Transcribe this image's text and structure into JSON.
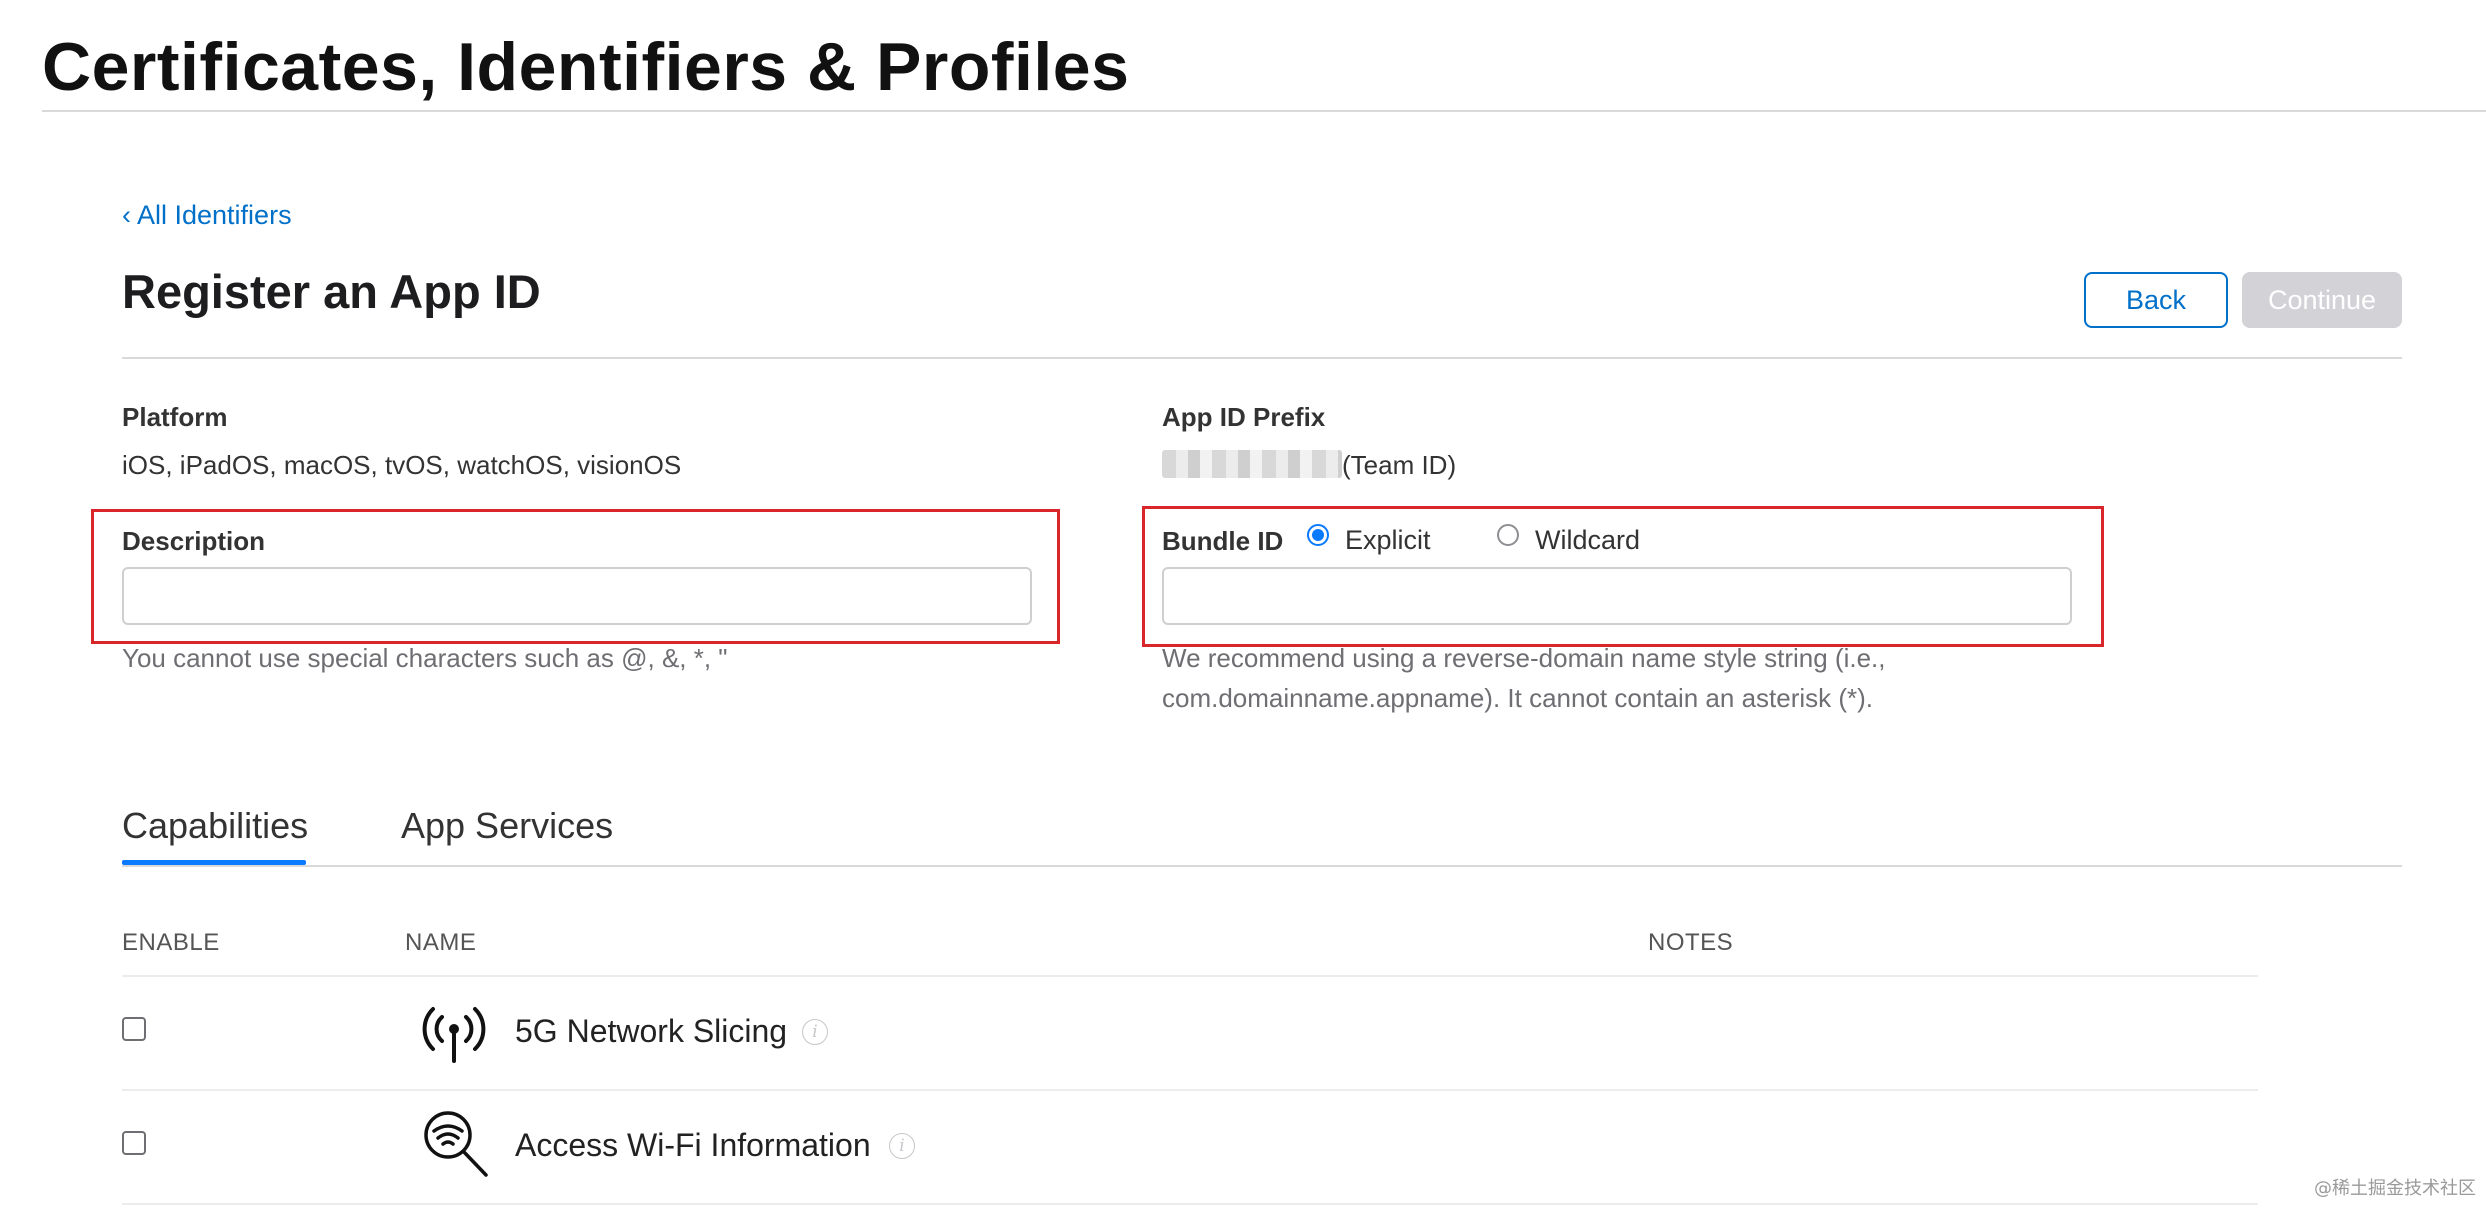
{
  "page": {
    "title": "Certificates, Identifiers & Profiles",
    "back_link": "‹ All Identifiers",
    "heading": "Register an App ID"
  },
  "buttons": {
    "back": "Back",
    "continue": "Continue"
  },
  "platform": {
    "label": "Platform",
    "value": "iOS, iPadOS, macOS, tvOS, watchOS, visionOS"
  },
  "app_id_prefix": {
    "label": "App ID Prefix",
    "suffix": "(Team ID)"
  },
  "description": {
    "label": "Description",
    "value": "",
    "helper": "You cannot use special characters such as @, &, *, \""
  },
  "bundle_id": {
    "label": "Bundle ID",
    "options": [
      "Explicit",
      "Wildcard"
    ],
    "selected": "Explicit",
    "value": "",
    "helper_line1": "We recommend using a reverse-domain name style string (i.e.,",
    "helper_line2": "com.domainname.appname). It cannot contain an asterisk (*)."
  },
  "tabs": [
    {
      "label": "Capabilities",
      "active": true
    },
    {
      "label": "App Services",
      "active": false
    }
  ],
  "table": {
    "columns": [
      "ENABLE",
      "NAME",
      "NOTES"
    ],
    "rows": [
      {
        "name": "5G Network Slicing",
        "icon": "antenna-icon",
        "enabled": false
      },
      {
        "name": "Access Wi-Fi Information",
        "icon": "wifi-search-icon",
        "enabled": false
      }
    ]
  },
  "watermark": "@稀土掘金技术社区",
  "colors": {
    "accent": "#0070c9",
    "highlight": "#d9262b",
    "disabled_button": "#d2d2d7"
  }
}
